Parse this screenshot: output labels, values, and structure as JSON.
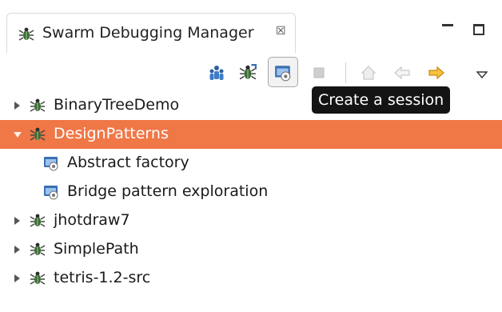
{
  "view": {
    "title": "Swarm Debugging Manager",
    "close_glyph": "☒",
    "tab_icon": "swarm-bug-icon"
  },
  "window_controls": {
    "minimize": "minimize-icon",
    "maximize": "maximize-icon"
  },
  "toolbar": {
    "buttons": [
      {
        "name": "swarm-people-icon"
      },
      {
        "name": "swarm-import-icon"
      },
      {
        "name": "create-session-icon",
        "pressed": true
      },
      {
        "name": "stop-icon",
        "enabled": false
      },
      {
        "name": "home-icon",
        "enabled": false
      },
      {
        "name": "back-arrow-icon",
        "enabled": false
      },
      {
        "name": "forward-arrow-icon",
        "enabled": true
      },
      {
        "name": "view-menu-icon"
      }
    ],
    "tooltip": "Create a session"
  },
  "colors": {
    "selection": "#f07746",
    "forward_arrow": "#f2b21a",
    "project_icon": "#3c6b36",
    "session_icon": "#3b6fb3"
  },
  "tree": {
    "items": [
      {
        "label": "BinaryTreeDemo",
        "level": 0,
        "expanded": false
      },
      {
        "label": "DesignPatterns",
        "level": 0,
        "expanded": true,
        "selected": true
      },
      {
        "label": "Abstract factory",
        "level": 1,
        "kind": "session"
      },
      {
        "label": "Bridge pattern exploration",
        "level": 1,
        "kind": "session"
      },
      {
        "label": "jhotdraw7",
        "level": 0,
        "expanded": false
      },
      {
        "label": "SimplePath",
        "level": 0,
        "expanded": false
      },
      {
        "label": "tetris-1.2-src",
        "level": 0,
        "expanded": false
      }
    ]
  }
}
